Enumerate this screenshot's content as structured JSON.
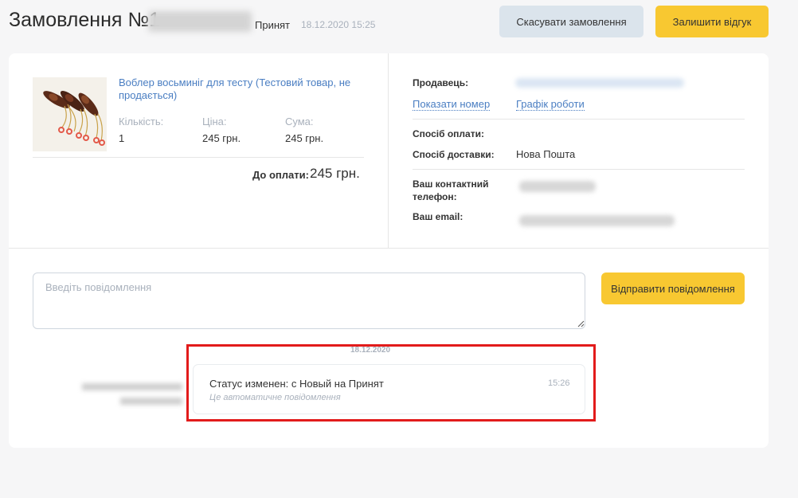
{
  "header": {
    "title": "Замовлення №1",
    "status": "Принят",
    "date": "18.12.2020 15:25",
    "cancel_label": "Скасувати замовлення",
    "review_label": "Залишити відгук"
  },
  "product": {
    "name": "Воблер восьминіг для тесту (Тестовий товар, не продається)",
    "qty_label": "Кількість:",
    "qty": "1",
    "price_label": "Ціна:",
    "price": "245 грн.",
    "sum_label": "Сума:",
    "sum": "245 грн.",
    "total_label": "До оплати:",
    "total": "245 грн."
  },
  "info": {
    "seller_label": "Продавець:",
    "show_number": "Показати номер",
    "schedule": "Графік роботи",
    "payment_label": "Спосіб оплати:",
    "delivery_label": "Спосіб доставки:",
    "delivery_value": "Нова Пошта",
    "phone_label": "Ваш контактний телефон:",
    "email_label": "Ваш email:"
  },
  "chat": {
    "placeholder": "Введіть повідомлення",
    "send_label": "Відправити повідомлення",
    "date": "18.12.2020",
    "message": "Статус изменен: с Новый на Принят",
    "time": "15:26",
    "note": "Це автоматичне повідомлення"
  },
  "colors": {
    "accent_yellow": "#f8c831",
    "link_blue": "#4a7ec2",
    "highlight_red": "#e21b1b",
    "muted": "#a9b1bc"
  }
}
